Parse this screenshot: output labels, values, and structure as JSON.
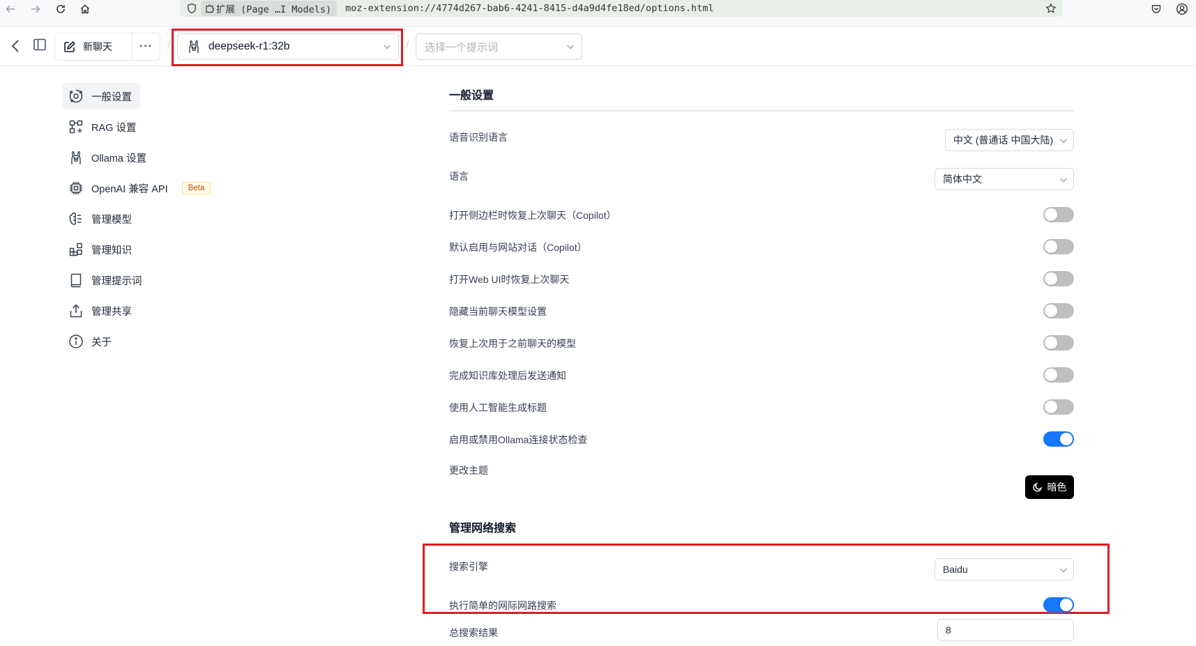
{
  "browser": {
    "extension_chip": "扩展 (Page …I Models)",
    "url": "moz-extension://4774d267-bab6-4241-8415-d4a9d4fe18ed/options.html"
  },
  "header": {
    "new_chat_label": "新聊天",
    "more_label": "···",
    "separator": "/",
    "model_value": "deepseek-r1:32b",
    "prompt_placeholder": "选择一个提示词"
  },
  "sidebar": {
    "items": [
      {
        "label": "一般设置",
        "icon": "settings-orbit-icon",
        "active": true
      },
      {
        "label": "RAG 设置",
        "icon": "rag-icon"
      },
      {
        "label": "Ollama 设置",
        "icon": "llama-icon"
      },
      {
        "label": "OpenAI 兼容 API",
        "icon": "chip-icon",
        "badge": "Beta"
      },
      {
        "label": "管理模型",
        "icon": "brain-icon"
      },
      {
        "label": "管理知识",
        "icon": "blocks-icon"
      },
      {
        "label": "管理提示词",
        "icon": "book-icon"
      },
      {
        "label": "管理共享",
        "icon": "share-icon"
      },
      {
        "label": "关于",
        "icon": "info-icon"
      }
    ]
  },
  "general": {
    "title": "一般设置",
    "speech_lang_label": "语音识别语言",
    "speech_lang_value": "中文 (普通话 中国大陆)",
    "language_label": "语言",
    "language_value": "简体中文",
    "toggles": [
      {
        "label": "打开侧边栏时恢复上次聊天（Copilot）",
        "on": false
      },
      {
        "label": "默认启用与网站对话（Copilot）",
        "on": false
      },
      {
        "label": "打开Web UI时恢复上次聊天",
        "on": false
      },
      {
        "label": "隐藏当前聊天模型设置",
        "on": false
      },
      {
        "label": "恢复上次用于之前聊天的模型",
        "on": false
      },
      {
        "label": "完成知识库处理后发送通知",
        "on": false
      },
      {
        "label": "使用人工智能生成标题",
        "on": false
      },
      {
        "label": "启用或禁用Ollama连接状态检查",
        "on": true
      }
    ],
    "theme_label": "更改主题",
    "theme_button": "暗色"
  },
  "web_search": {
    "title": "管理网络搜索",
    "engine_label": "搜索引擎",
    "engine_value": "Baidu",
    "simple_search_label": "执行简单的网际网路搜索",
    "simple_search_on": true,
    "total_results_label": "总搜索结果",
    "total_results_value": "8"
  },
  "colors": {
    "toggle_on": "#1677ff",
    "toggle_off": "#bfbfbf",
    "highlight": "#e01b24"
  }
}
